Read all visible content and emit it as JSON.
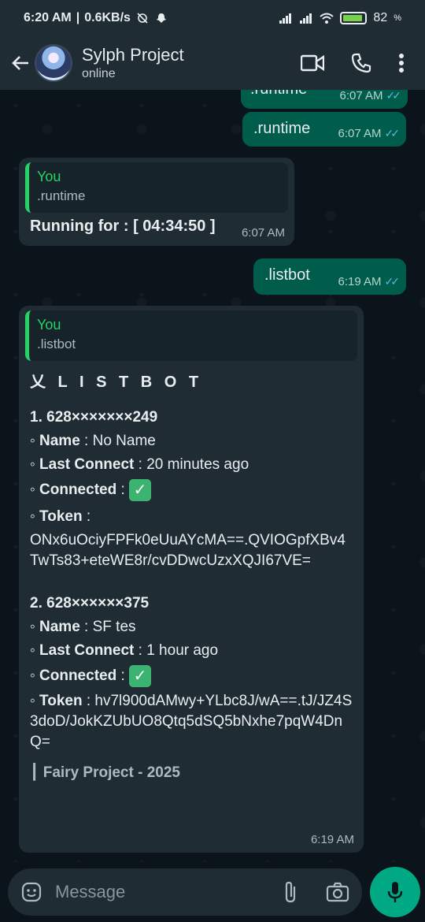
{
  "status_bar": {
    "time": "6:20 AM",
    "speed": "0.6KB/s",
    "battery": "82"
  },
  "header": {
    "title": "Sylph Project",
    "subtitle": "online"
  },
  "messages": {
    "m1": {
      "text": ".runtime",
      "time": "6:07 AM"
    },
    "m2": {
      "text": ".runtime",
      "time": "6:07 AM"
    },
    "m3": {
      "quote_author": "You",
      "quote_text": ".runtime",
      "text_label": "Running for : [ 04:34:50 ]",
      "time": "6:07 AM"
    },
    "m4": {
      "text": ".listbot",
      "time": "6:19 AM"
    },
    "m5": {
      "quote_author": "You",
      "quote_text": ".listbot",
      "title": "乂 L I S T B O T",
      "bots": [
        {
          "header": "1. 628×××××××249",
          "name_label": "Name",
          "name_value": " : No Name",
          "last_label": "Last Connect",
          "last_value": " : 20 minutes ago",
          "connected_label": "Connected",
          "connected_sep": " : ",
          "token_label": "Token",
          "token_value": " :",
          "token": "ONx6uOciyFPFk0eUuAYcMA==.QVIOGpfXBv4TwTs83+eteWE8r/cvDDwcUzxXQJI67VE="
        },
        {
          "header": "2. 628××××××375",
          "name_label": "Name",
          "name_value": " : SF tes",
          "last_label": "Last Connect",
          "last_value": " : 1 hour ago",
          "connected_label": "Connected",
          "connected_sep": " : ",
          "token_label": "Token",
          "token_value": " : ",
          "token": "hv7l900dAMwy+YLbc8J/wA==.tJ/JZ4S3doD/JokKZUbUO8Qtq5dSQ5bNxhe7pqW4DnQ="
        }
      ],
      "footer": "┃ Fairy Project - 2025",
      "time": "6:19 AM"
    }
  },
  "input": {
    "placeholder": "Message"
  },
  "colors": {
    "accent": "#00a884",
    "outgoing": "#005c4b",
    "incoming": "#1f2c34",
    "quote_bar": "#25d366",
    "read_ticks": "#53bdeb"
  },
  "icons": {
    "back": "arrow-left-icon",
    "video": "video-call-icon",
    "phone": "phone-icon",
    "menu": "more-vert-icon",
    "emoji": "emoji-icon",
    "attach": "paperclip-icon",
    "camera": "camera-icon",
    "mic": "mic-icon"
  }
}
